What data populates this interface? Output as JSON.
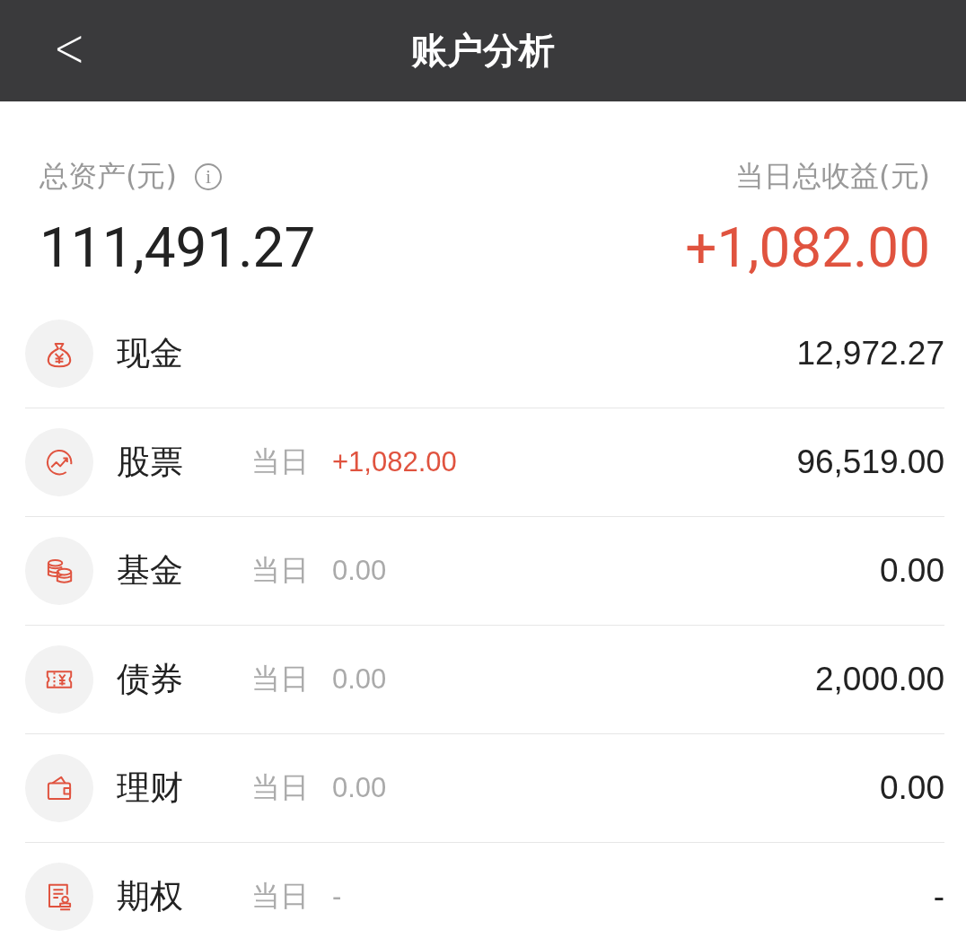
{
  "header": {
    "back": "<",
    "title": "账户分析"
  },
  "summary": {
    "total_label": "总资产(元)",
    "info": "i",
    "total": "111,491.27",
    "profit_label": "当日总收益(元)",
    "profit": "+1,082.00",
    "profit_rising": true
  },
  "accounts": [
    {
      "name": "现金",
      "amount": "12,972.27"
    },
    {
      "name": "股票",
      "daily_label": "当日",
      "daily": "+1,082.00",
      "rising": true,
      "amount": "96,519.00"
    },
    {
      "name": "基金",
      "daily_label": "当日",
      "daily": "0.00",
      "rising": false,
      "amount": "0.00"
    },
    {
      "name": "债券",
      "daily_label": "当日",
      "daily": "0.00",
      "rising": false,
      "amount": "2,000.00"
    },
    {
      "name": "理财",
      "daily_label": "当日",
      "daily": "0.00",
      "rising": false,
      "amount": "0.00"
    },
    {
      "name": "期权",
      "daily_label": "当日",
      "daily": "-",
      "rising": false,
      "amount": "-"
    }
  ]
}
